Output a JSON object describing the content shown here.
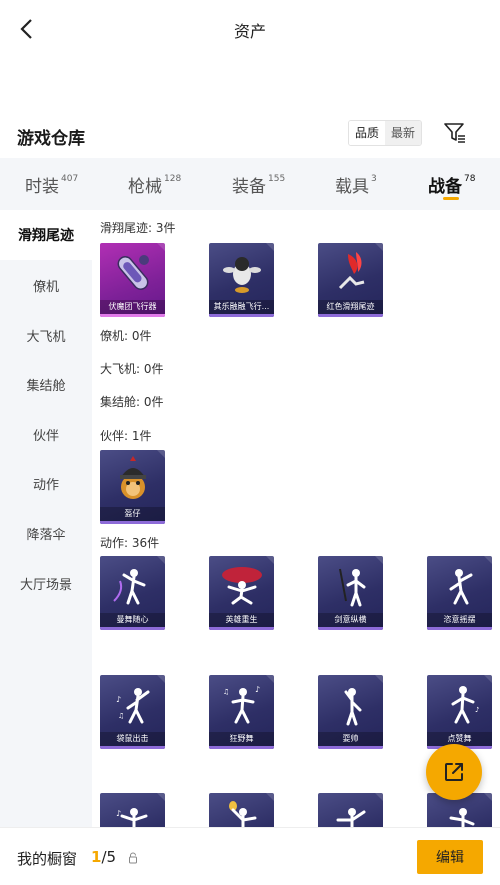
{
  "header": {
    "title": "资产"
  },
  "section": {
    "title": "游戏仓库",
    "sort_options": [
      "品质",
      "最新"
    ]
  },
  "tabs": [
    {
      "label": "时装",
      "count": "407"
    },
    {
      "label": "枪械",
      "count": "128"
    },
    {
      "label": "装备",
      "count": "155"
    },
    {
      "label": "载具",
      "count": "3"
    },
    {
      "label": "战备",
      "count": "78"
    }
  ],
  "sidebar": {
    "items": [
      {
        "label": "滑翔尾迹"
      },
      {
        "label": "僚机"
      },
      {
        "label": "大飞机"
      },
      {
        "label": "集结舱"
      },
      {
        "label": "伙伴"
      },
      {
        "label": "动作"
      },
      {
        "label": "降落伞"
      },
      {
        "label": "大厅场景"
      }
    ]
  },
  "groups": {
    "trail": {
      "label": "滑翔尾迹: 3件",
      "items": [
        "伏魔团飞行器",
        "其乐融融飞行...",
        "红色滑翔尾迹"
      ]
    },
    "wingman": {
      "label": "僚机: 0件"
    },
    "plane": {
      "label": "大飞机: 0件"
    },
    "pod": {
      "label": "集结舱: 0件"
    },
    "partner": {
      "label": "伙伴: 1件",
      "items": [
        "盔仔"
      ]
    },
    "emote": {
      "label": "动作: 36件",
      "items": [
        "曼舞随心",
        "英雄重生",
        "剑意纵横",
        "恣意摇摆",
        "袋鼠出击",
        "狂野舞",
        "耍帅",
        "点赞舞",
        "",
        "",
        "",
        ""
      ]
    }
  },
  "bottom": {
    "label": "我的橱窗",
    "current": "1",
    "total": "/5",
    "edit": "编辑"
  },
  "colors": {
    "accent": "#f5a800",
    "card_purple": "#2e2f66",
    "card_pink": "#7e2198"
  }
}
